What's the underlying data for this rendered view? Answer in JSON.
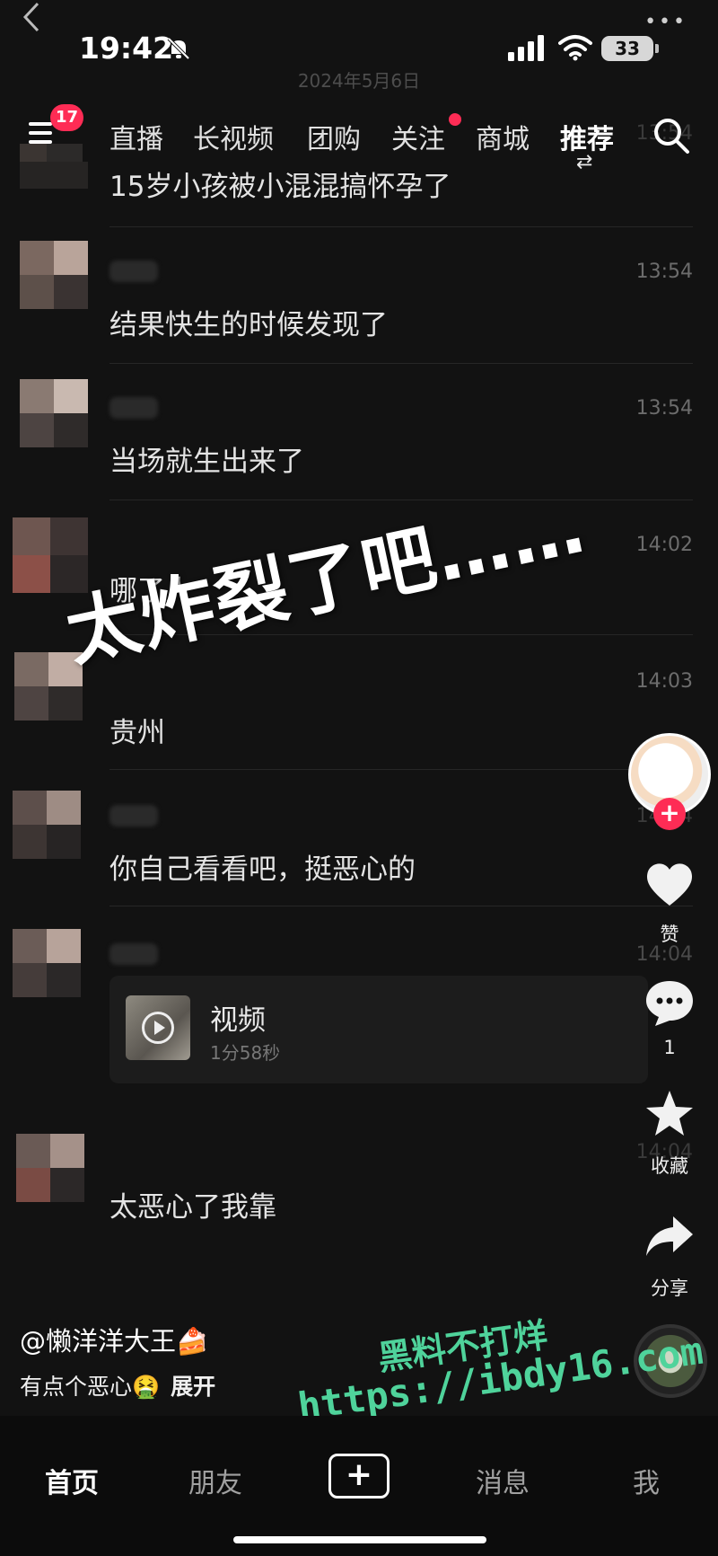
{
  "status_bar": {
    "time": "19:42",
    "battery": "33"
  },
  "chat_date": "2024年5月6日",
  "top_nav": {
    "badge": "17",
    "tabs": [
      {
        "label": "直播"
      },
      {
        "label": "长视频"
      },
      {
        "label": "团购"
      },
      {
        "label": "关注"
      },
      {
        "label": "商城"
      },
      {
        "label": "推荐"
      }
    ],
    "partial_time": "13:54"
  },
  "messages": [
    {
      "time": "",
      "text": "15岁小孩被小混混搞怀孕了"
    },
    {
      "time": "13:54",
      "text": "结果快生的时候发现了"
    },
    {
      "time": "13:54",
      "text": "当场就生出来了"
    },
    {
      "time": "14:02",
      "text": "哪了人"
    },
    {
      "time": "14:03",
      "text": "贵州"
    },
    {
      "time": "14:04",
      "text": "你自己看看吧，挺恶心的"
    },
    {
      "time": "14:04",
      "text": ""
    },
    {
      "time": "14:04",
      "text": "太恶心了我靠"
    }
  ],
  "video_card": {
    "title": "视频",
    "duration": "1分58秒"
  },
  "overlay_text": "太炸裂了吧……",
  "actions": {
    "like_label": "赞",
    "comment_count": "1",
    "favorite_label": "收藏",
    "share_label": "分享",
    "follow_symbol": "+"
  },
  "post": {
    "author": "@懒洋洋大王🍰",
    "caption": "有点个恶心🤮",
    "expand": "展开"
  },
  "watermark": {
    "line1": "黑料不打烊",
    "line2": "https://ibdy16.com"
  },
  "bottom_nav": {
    "items": [
      {
        "label": "首页"
      },
      {
        "label": "朋友"
      },
      {
        "label": "+"
      },
      {
        "label": "消息"
      },
      {
        "label": "我"
      }
    ]
  },
  "colors": {
    "background": "#121212",
    "accent_red": "#fe2c55",
    "watermark_green": "#4fd39b"
  }
}
